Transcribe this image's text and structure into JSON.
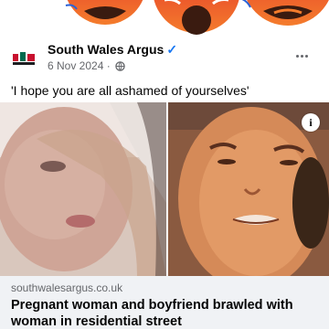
{
  "post": {
    "page_name": "South Wales Argus",
    "follow_glyph": "✓",
    "date": "6 Nov 2024",
    "meta_separator": " · ",
    "caption": "'I hope you are all ashamed of yourselves'"
  },
  "reactions": {
    "emoji_names": [
      "angry-emoji",
      "angry-emoji",
      "angry-emoji",
      "angry-emoji"
    ]
  },
  "link_preview": {
    "domain": "southwalesargus.co.uk",
    "title": "Pregnant woman and boyfriend brawled with woman in residential street",
    "info_glyph": "i"
  },
  "icons": {
    "globe": "globe-icon",
    "more": "more-horizontal-icon",
    "info": "info-icon"
  },
  "colors": {
    "page_name": "#050505",
    "meta": "#65676b",
    "follow": "#1877f2",
    "link_meta_bg": "#f0f2f5",
    "angry_red": "#e0242a",
    "angry_orange": "#f47c2c"
  }
}
